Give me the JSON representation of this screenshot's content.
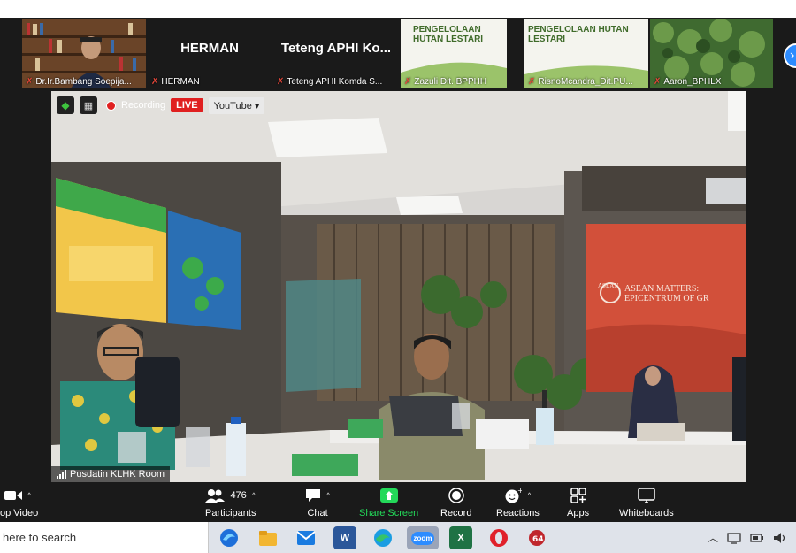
{
  "participants_strip": [
    {
      "name": "Dr.Ir.Bambang Soepija...",
      "display": ""
    },
    {
      "name": "HERMAN",
      "display": "HERMAN"
    },
    {
      "name": "Teteng APHI Komda S...",
      "display": "Teteng APHI Ko..."
    },
    {
      "name": "Zazuli Dit. BPPHH",
      "display": ""
    },
    {
      "name": "RisnoMcandra_Dit.PU...",
      "display": ""
    },
    {
      "name": "Aaron_BPHLX",
      "display": ""
    }
  ],
  "slides": {
    "slide1_title": "PENGELOLAAN HUTAN LESTARI",
    "slide2_title": "PENGELOLAAN HUTAN LESTARI"
  },
  "recording_bar": {
    "recording_label": "Recording",
    "live_label": "LIVE",
    "youtube_label": "YouTube"
  },
  "main_video": {
    "room_label": "Pusdatin KLHK Room",
    "banner_title": "ASEAN MATTERS:",
    "banner_subtitle": "EPICENTRUM OF GR",
    "banner_logo": "ASEAN"
  },
  "toolbar": {
    "video_label": "op Video",
    "participants_label": "Participants",
    "participants_count": "476",
    "chat_label": "Chat",
    "share_label": "Share Screen",
    "record_label": "Record",
    "reactions_label": "Reactions",
    "apps_label": "Apps",
    "whiteboards_label": "Whiteboards"
  },
  "taskbar": {
    "search_placeholder": "here to search",
    "apps": [
      "edge-legacy",
      "file-explorer",
      "mail",
      "word",
      "edge",
      "zoom",
      "excel",
      "opera",
      "games"
    ],
    "zoom_label": "zoom"
  },
  "colors": {
    "share_green": "#23d959",
    "live_red": "#e02020",
    "mic_off_red": "#e8473a",
    "zoom_blue": "#2d8cff"
  }
}
